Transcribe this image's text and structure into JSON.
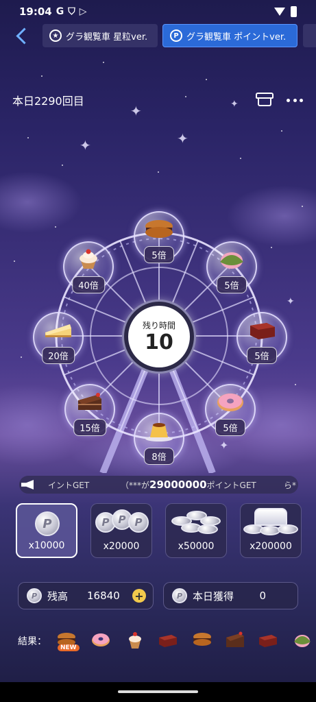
{
  "status": {
    "time": "19:04",
    "g_icon": "G"
  },
  "tabs": [
    {
      "label": "グラ観覧車 星粒ver.",
      "icon": "star-medal-icon"
    },
    {
      "label": "グラ観覧車 ポイントver.",
      "icon": "point-medal-icon"
    }
  ],
  "header": {
    "daily_count": "本日2290回目"
  },
  "wheel": {
    "timer_label": "残り時間",
    "timer_value": "10",
    "gondolas": [
      {
        "item": "dorayaki",
        "multiplier": "5倍"
      },
      {
        "item": "sakura-mochi",
        "multiplier": "5倍"
      },
      {
        "item": "yokan",
        "multiplier": "5倍"
      },
      {
        "item": "donut",
        "multiplier": "5倍"
      },
      {
        "item": "pudding",
        "multiplier": "8倍"
      },
      {
        "item": "chocolate-cake",
        "multiplier": "15倍"
      },
      {
        "item": "cheesecake",
        "multiplier": "20倍"
      },
      {
        "item": "cupcake",
        "multiplier": "40倍"
      }
    ]
  },
  "ticker": {
    "left": "イントGET",
    "user_mask": "（***",
    "middle": "が",
    "amount": "29000000",
    "suffix": "ポイントGET",
    "right": "ら*"
  },
  "bets": [
    {
      "label": "x10000",
      "selected": true
    },
    {
      "label": "x20000",
      "selected": false
    },
    {
      "label": "x50000",
      "selected": false
    },
    {
      "label": "x200000",
      "selected": false
    }
  ],
  "balance": {
    "label": "残高",
    "value": "16840"
  },
  "today": {
    "label": "本日獲得",
    "value": "0"
  },
  "coin_glyph": "P",
  "results": {
    "label": "結果：",
    "new_badge": "NEW",
    "items": [
      "dorayaki",
      "donut",
      "cupcake",
      "yokan",
      "dorayaki",
      "chocolate-cake",
      "yokan",
      "sakura-mochi"
    ]
  }
}
